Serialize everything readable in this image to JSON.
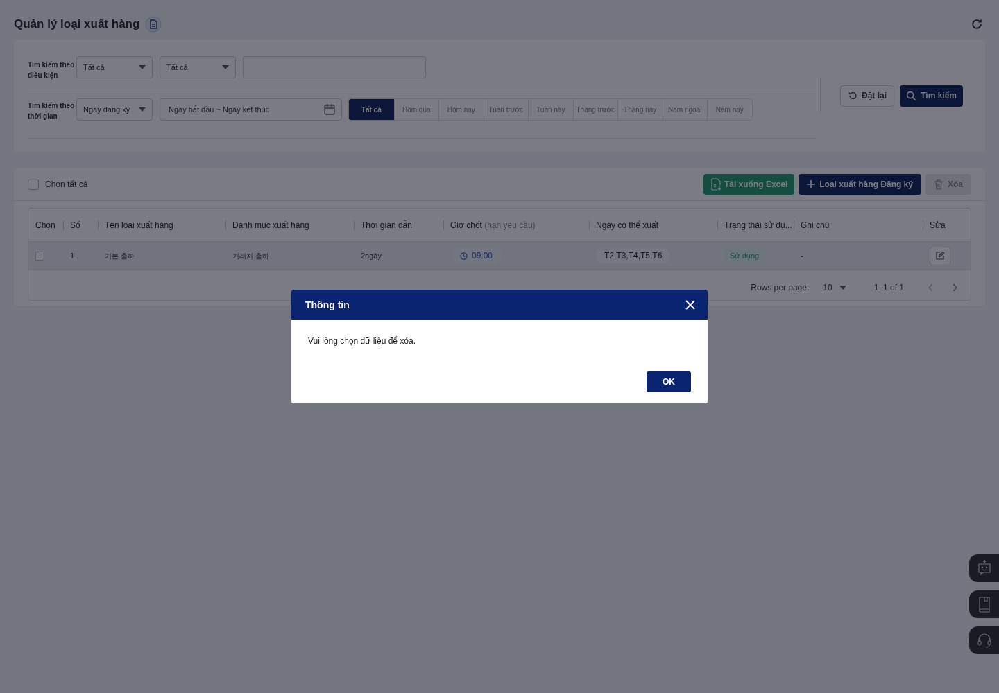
{
  "page": {
    "title": "Quản lý loại xuất hàng"
  },
  "filters": {
    "condition_label": "Tìm kiếm theo điều kiện",
    "condition_selects": [
      "Tất cả",
      "Tất cả"
    ],
    "time_label": "Tìm kiếm theo thời gian",
    "date_type": "Ngày đăng ký",
    "date_range_placeholder": "Ngày bắt đầu ~ Ngày kết thúc",
    "quick_ranges": [
      {
        "label": "Tất cả",
        "selected": true
      },
      {
        "label": "Hôm qua",
        "selected": false
      },
      {
        "label": "Hôm nay",
        "selected": false
      },
      {
        "label": "Tuần trước",
        "selected": false
      },
      {
        "label": "Tuần này",
        "selected": false
      },
      {
        "label": "Tháng trước",
        "selected": false
      },
      {
        "label": "Tháng này",
        "selected": false
      },
      {
        "label": "Năm ngoái",
        "selected": false
      },
      {
        "label": "Năm nay",
        "selected": false
      }
    ],
    "reset_button": "Đặt lại",
    "search_button": "Tìm kiếm"
  },
  "toolbar": {
    "select_all": {
      "label": "Chọn tất cả",
      "checked": false
    },
    "excel_button": "Tải xuống Excel",
    "register_button": "Loại xuất hàng Đăng ký",
    "delete_button": {
      "label": "Xóa",
      "disabled": true
    }
  },
  "table": {
    "columns": [
      {
        "label": "Chọn"
      },
      {
        "label": "Số"
      },
      {
        "label": "Tên loại xuất hàng"
      },
      {
        "label": "Danh mục xuất hàng"
      },
      {
        "label": "Thời gian dẫn"
      },
      {
        "label": "Giờ chốt",
        "hint": "(hạn yêu cầu)"
      },
      {
        "label": "Ngày có thể xuất"
      },
      {
        "label": "Trạng thái sử dụ..."
      },
      {
        "label": "Ghi chú"
      },
      {
        "label": "Sửa"
      }
    ],
    "rows": [
      {
        "checked": false,
        "number": "1",
        "name": "기본 출하",
        "category": "거래처 출하",
        "lead_time": "2ngày",
        "cutoff": "09:00",
        "days": "T2,T3,T4,T5,T6",
        "status": "Sử dụng",
        "note": "-"
      }
    ]
  },
  "pagination": {
    "rows_per_page_label": "Rows per page:",
    "rows_per_page": "10",
    "range": "1–1 of 1"
  },
  "dialog": {
    "title": "Thông tin",
    "message": "Vui lòng chọn dữ liệu để xóa.",
    "ok_button": "OK"
  }
}
